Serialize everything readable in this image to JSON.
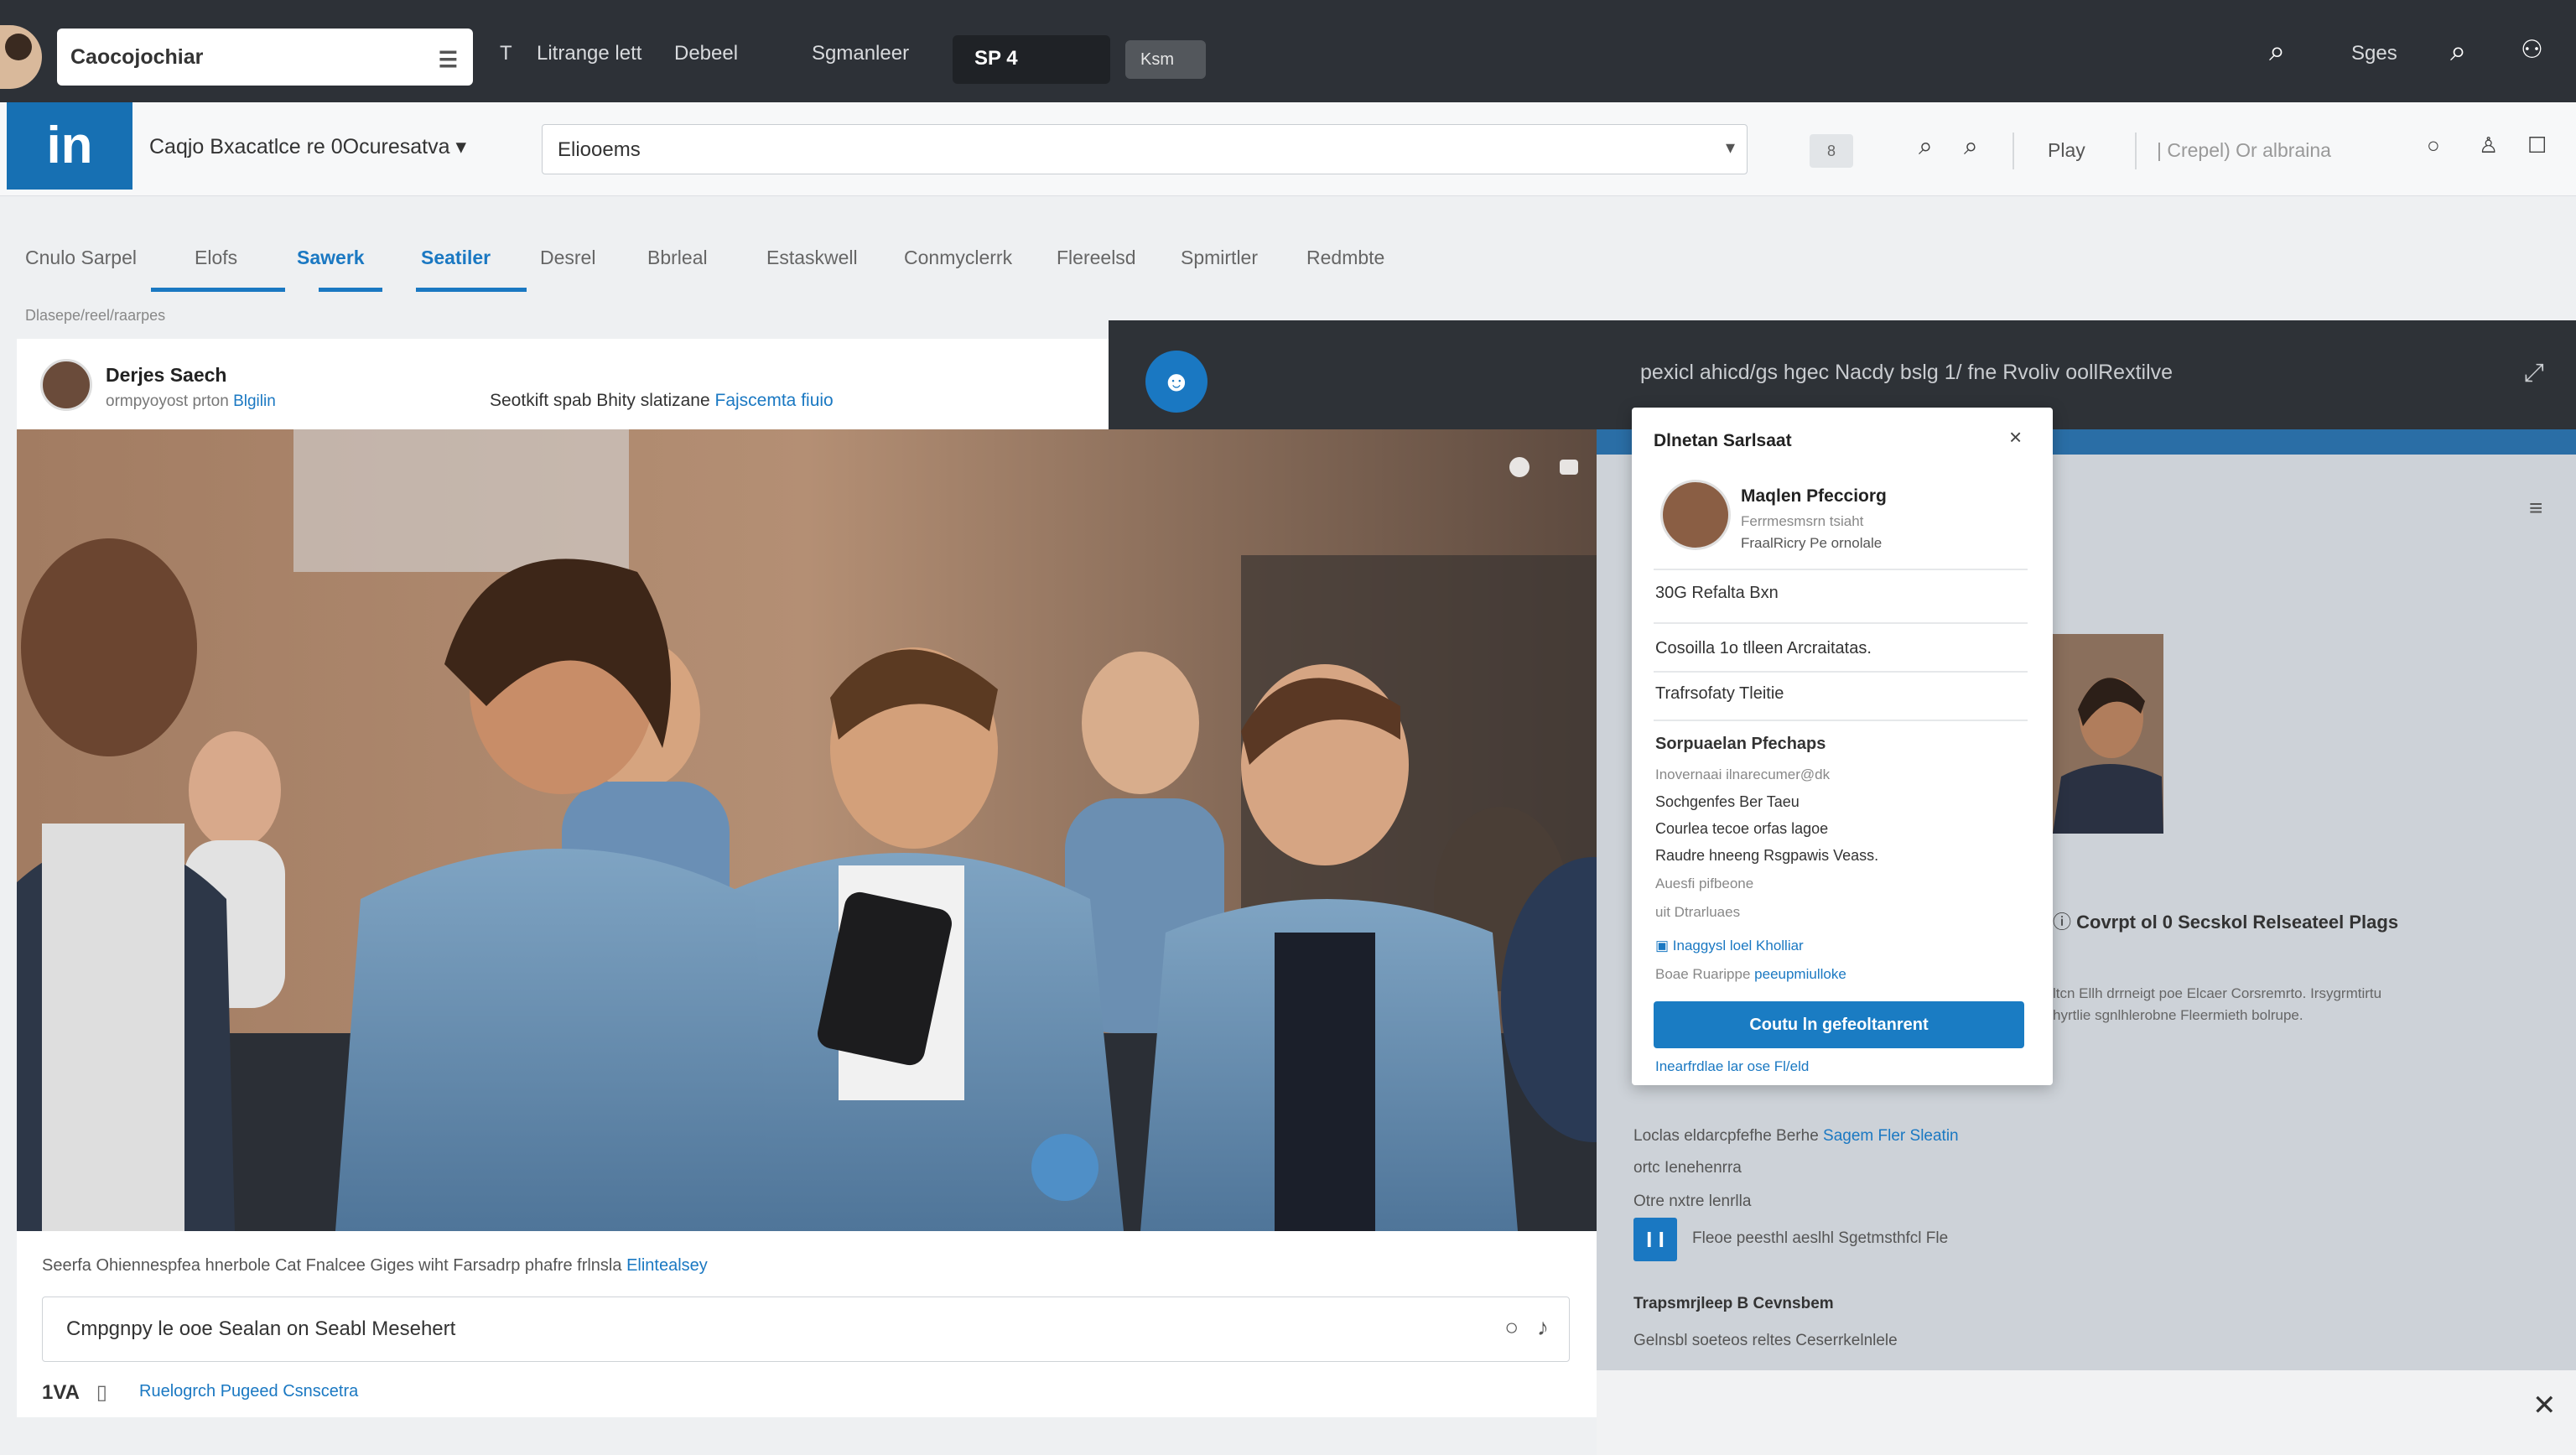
{
  "topbar": {
    "search_value": "Caocojochiar",
    "nav": [
      "T",
      "Litrange lett",
      "Debeel",
      "Sgmanleer"
    ],
    "dark_tab": "SP 4",
    "grey_tab": "Ksm",
    "right_text": "Sges"
  },
  "appbar": {
    "logo": "in",
    "workspace": "Caqjo Bxacatlce re 0Ocuresatva",
    "search_value": "Eliooems",
    "small_btn": "8",
    "play": "Play",
    "meta": "| Crepel) Or albraina"
  },
  "tabs": [
    "Cnulo Sarpel",
    "Elofs",
    "Sawerk",
    "Seatiler",
    "Desrel",
    "Bbrleal",
    "Estaskwell",
    "Conmyclerrk",
    "Flereelsd",
    "Spmirtler",
    "Redmbte"
  ],
  "active_tab": "Seatiler",
  "breadcrumb": "Dlasepe/reel/raarpes",
  "post": {
    "author": "Derjes Saech",
    "subtitle": "ormpyoyost prton",
    "subtitle_link": "Blgilin",
    "announcement": "Seotkift spab Bhity slatizane",
    "announcement_link": "Fajscemta fiuio"
  },
  "banner": {
    "text": "pexicl ahicd/gs hgec Nacdy bslg 1/ fne Rvoliv oollRextilve"
  },
  "caption": {
    "text": "Seerfa Ohiennespfea hnerbole Cat Fnalcee Giges wiht Farsadrp phafre frlnsla",
    "link": "Elintealsey"
  },
  "comment": {
    "placeholder": "Cmpgnpy le ooe Sealan on Seabl Mesehert"
  },
  "reactions": {
    "count": "1VA",
    "link": "Ruelogrch Pugeed Csnscetra"
  },
  "popover": {
    "title": "Dlnetan Sarlsaat",
    "person_name": "Maqlen Pfecciorg",
    "person_sub1": "Ferrmesmsrn tsiaht",
    "person_sub2": "FraalRicry Pe ornolale",
    "stat": "30G Refalta Bxn",
    "line1": "Cosoilla 1o tlleen Arcraitatas.",
    "line2": "Trafrsofaty Tleitie",
    "section": "Sorpuaelan Pfechaps",
    "muted1": "Inovernaai ilnarecumer@dk",
    "items": [
      "Sochgenfes Ber Taeu",
      "Courlea tecoe orfas lagoe",
      "Raudre hneeng Rsgpawis Veass.",
      "Auesfi pifbeone",
      "uit Dtrarluaes"
    ],
    "link1": "Inaggysl loel Kholliar",
    "link2_prefix": "Boae Ruarippe",
    "link2": "peeupmiulloke",
    "cta": "Coutu ln gefeoltanrent",
    "footer": "Inearfrdlae lar ose Fl/eld"
  },
  "right_panel": {
    "title": "Covrpt ol 0 Secskol Relseateel Plags",
    "desc": "ltcn Ellh drrneigt poe Elcaer Corsremrto. Irsygrmtirtu hyrtlie sgnlhlerobne Fleermieth bolrupe.",
    "line1": "Loclas eldarcpfefhe Berhe",
    "line1_link": "Sagem Fler Sleatin",
    "line2": "ortc Ienehenrra",
    "line3": "Otre nxtre lenrlla",
    "blue_icon": "I I",
    "line4": "Fleoe peesthl aeslhl Sgetmsthfcl Fle",
    "bold": "Trapsmrjleep B Cevnsbem",
    "line5": "Gelnsbl soeteos reltes Ceserrkelnlele"
  },
  "icons": [
    "search-icon",
    "menu-icon",
    "user-settings-icon",
    "refresh-icon",
    "user-icon",
    "copy-icon",
    "close-icon",
    "mic-icon",
    "bookmark-icon",
    "settings-icon"
  ],
  "colors": {
    "brand": "#1a78c2",
    "topbar": "#2d3137",
    "banner": "#2e3237"
  }
}
